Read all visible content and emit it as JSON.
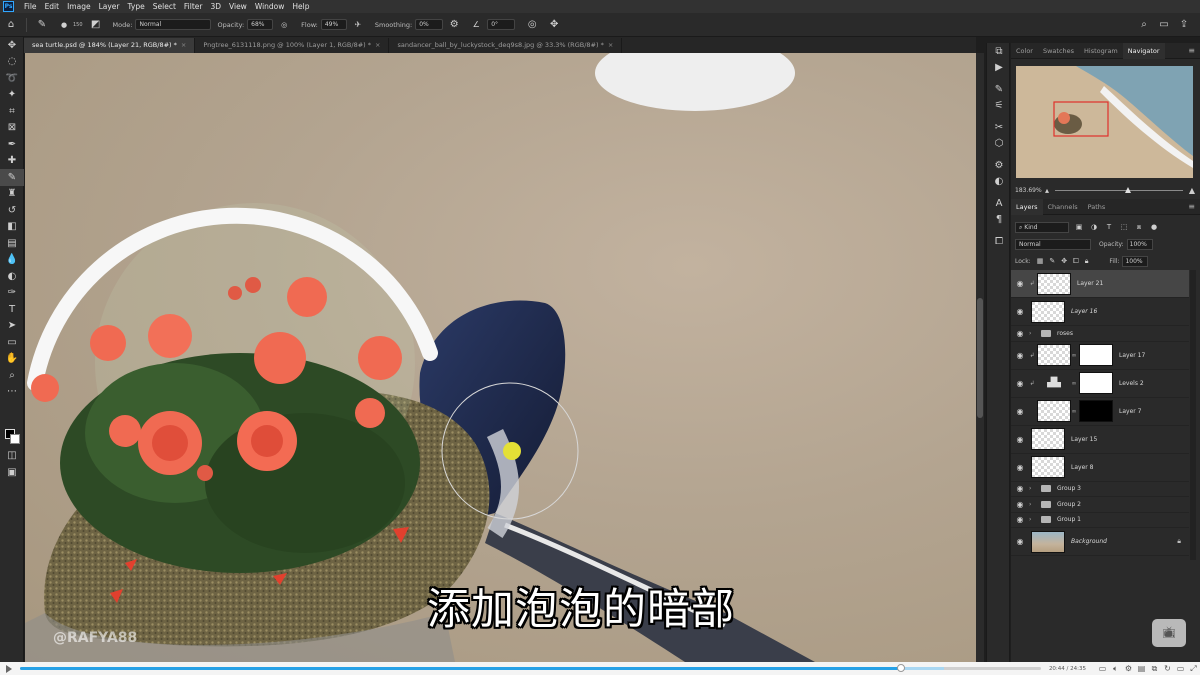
{
  "menubar": {
    "logo": "Ps",
    "items": [
      "File",
      "Edit",
      "Image",
      "Layer",
      "Type",
      "Select",
      "Filter",
      "3D",
      "View",
      "Window",
      "Help"
    ]
  },
  "options": {
    "brush_size": "150",
    "mode_label": "Mode:",
    "mode_value": "Normal",
    "opacity_label": "Opacity:",
    "opacity_value": "68%",
    "flow_label": "Flow:",
    "flow_value": "49%",
    "smoothing_label": "Smoothing:",
    "smoothing_value": "0%",
    "angle_value": "0°"
  },
  "tabs": [
    {
      "label": "sea turtle.psd @ 184% (Layer 21, RGB/8#) *",
      "active": true
    },
    {
      "label": "Pngtree_6131118.png @ 100% (Layer 1, RGB/8#) *",
      "active": false
    },
    {
      "label": "sandancer_ball_by_luckystock_deq9s8.jpg @ 33.3% (RGB/8#) *",
      "active": false
    }
  ],
  "canvas": {
    "subtitle": "添加泡泡的暗部",
    "watermark": "@RAFYA88"
  },
  "panels": {
    "top_tabs": [
      "Color",
      "Swatches",
      "Histogram",
      "Navigator"
    ],
    "active_top_tab": "Navigator",
    "zoom_value": "183.69%",
    "layer_tabs": [
      "Layers",
      "Channels",
      "Paths"
    ],
    "kind_label": "Kind",
    "blend_mode": "Normal",
    "opacity_label": "Opacity:",
    "opacity_value": "100%",
    "lock_label": "Lock:",
    "fill_label": "Fill:",
    "fill_value": "100%"
  },
  "layers": [
    {
      "name": "Layer 21",
      "selected": true,
      "type": "layer",
      "clipped": true
    },
    {
      "name": "Layer 16",
      "type": "layer",
      "italic": true
    },
    {
      "name": "roses",
      "type": "group"
    },
    {
      "name": "Layer 17",
      "type": "masked",
      "clipped": true
    },
    {
      "name": "Levels 2",
      "type": "adjustment",
      "clipped": true
    },
    {
      "name": "Layer 7",
      "type": "masked-black"
    },
    {
      "name": "Layer 15",
      "type": "layer"
    },
    {
      "name": "Layer 8",
      "type": "layer"
    },
    {
      "name": "Group 3",
      "type": "group"
    },
    {
      "name": "Group 2",
      "type": "group"
    },
    {
      "name": "Group 1",
      "type": "group"
    },
    {
      "name": "Background",
      "type": "background",
      "italic": true
    }
  ],
  "player": {
    "time": "20:44 / 24:35",
    "progress": 0.863,
    "buffered": 0.905
  },
  "icons": {
    "home": "home-icon",
    "brush": "brush-icon",
    "search": "search-icon",
    "eye": "eye-icon",
    "lock": "lock-icon",
    "folder": "folder-icon",
    "play": "play-icon",
    "tv": "tv-logo-icon"
  }
}
